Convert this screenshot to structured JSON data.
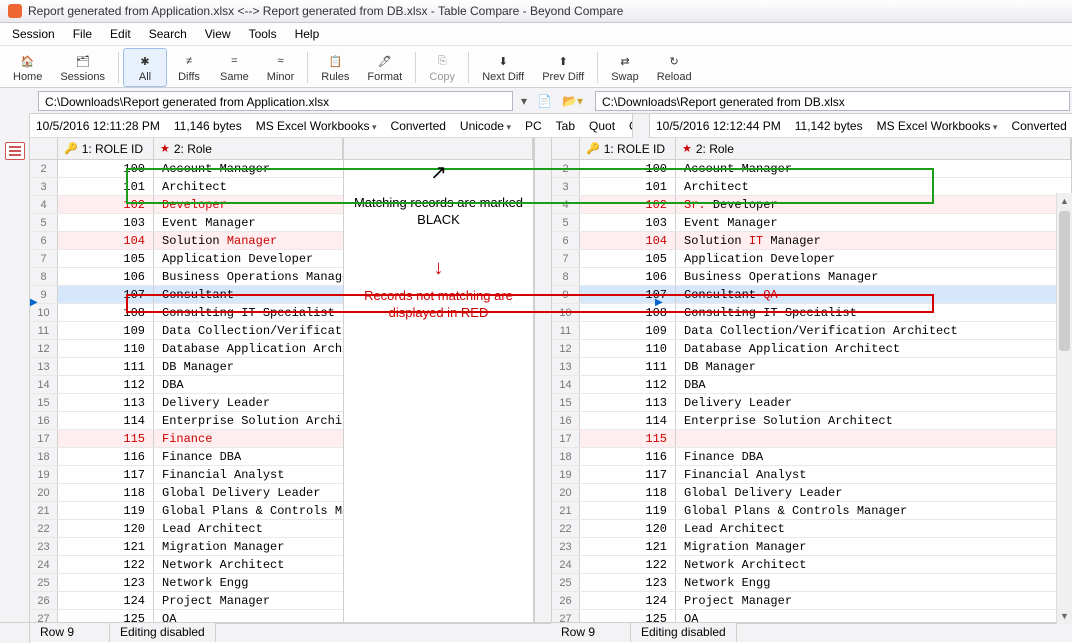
{
  "title": "Report generated from Application.xlsx <--> Report generated from DB.xlsx - Table Compare - Beyond Compare",
  "menus": [
    "Session",
    "File",
    "Edit",
    "Search",
    "View",
    "Tools",
    "Help"
  ],
  "toolbar": [
    {
      "label": "Home",
      "icon": "🏠",
      "name": "home-button"
    },
    {
      "label": "Sessions",
      "icon": "🗂",
      "name": "sessions-button"
    },
    {
      "sep": true
    },
    {
      "label": "All",
      "icon": "✱",
      "active": true,
      "name": "filter-all-button"
    },
    {
      "label": "Diffs",
      "icon": "≠",
      "name": "filter-diffs-button"
    },
    {
      "label": "Same",
      "icon": "=",
      "name": "filter-same-button"
    },
    {
      "label": "Minor",
      "icon": "≈",
      "name": "filter-minor-button"
    },
    {
      "sep": true
    },
    {
      "label": "Rules",
      "icon": "📋",
      "name": "rules-button"
    },
    {
      "label": "Format",
      "icon": "🖊",
      "name": "format-button"
    },
    {
      "sep": true
    },
    {
      "label": "Copy",
      "icon": "⎘",
      "name": "copy-button",
      "disabled": true
    },
    {
      "sep": true
    },
    {
      "label": "Next Diff",
      "icon": "⬇",
      "name": "next-diff-button"
    },
    {
      "label": "Prev Diff",
      "icon": "⬆",
      "name": "prev-diff-button"
    },
    {
      "sep": true
    },
    {
      "label": "Swap",
      "icon": "⇄",
      "name": "swap-button"
    },
    {
      "label": "Reload",
      "icon": "↻",
      "name": "reload-button"
    }
  ],
  "left": {
    "path": "C:\\Downloads\\Report generated from Application.xlsx",
    "meta": [
      "10/5/2016 12:11:28 PM",
      "11,146 bytes",
      "MS Excel Workbooks",
      "Converted",
      "Unicode",
      "PC",
      "Tab",
      "Quot",
      "C"
    ],
    "cols": [
      "1: ROLE ID",
      "2: Role"
    ],
    "rows": [
      {
        "n": 2,
        "id": "100",
        "role": "Account Manager",
        "diff": false
      },
      {
        "n": 3,
        "id": "101",
        "role": "Architect",
        "diff": false
      },
      {
        "n": 4,
        "id": "102",
        "role": "Developer",
        "diff": true,
        "idred": true,
        "rolered": true
      },
      {
        "n": 5,
        "id": "103",
        "role": "Event Manager",
        "diff": false
      },
      {
        "n": 6,
        "id": "104",
        "role": "Solution Manager",
        "diff": true,
        "idred": true,
        "roleparts": [
          {
            "t": "Solution ",
            "r": false
          },
          {
            "t": "Manager",
            "r": true
          }
        ]
      },
      {
        "n": 7,
        "id": "105",
        "role": "Application Developer",
        "diff": false
      },
      {
        "n": 8,
        "id": "106",
        "role": "Business Operations Manager",
        "diff": false
      },
      {
        "n": 9,
        "id": "107",
        "role": "Consultant",
        "diff": true,
        "sel": true
      },
      {
        "n": 10,
        "id": "108",
        "role": "Consulting IT Specialist",
        "diff": false
      },
      {
        "n": 11,
        "id": "109",
        "role": "Data Collection/Verification Architect",
        "diff": false
      },
      {
        "n": 12,
        "id": "110",
        "role": "Database Application Architect",
        "diff": false
      },
      {
        "n": 13,
        "id": "111",
        "role": "DB Manager",
        "diff": false
      },
      {
        "n": 14,
        "id": "112",
        "role": "DBA",
        "diff": false
      },
      {
        "n": 15,
        "id": "113",
        "role": "Delivery Leader",
        "diff": false
      },
      {
        "n": 16,
        "id": "114",
        "role": "Enterprise Solution Architect",
        "diff": false
      },
      {
        "n": 17,
        "id": "115",
        "role": "Finance",
        "diff": true,
        "idred": true,
        "rolered": true
      },
      {
        "n": 18,
        "id": "116",
        "role": "Finance DBA",
        "diff": false
      },
      {
        "n": 19,
        "id": "117",
        "role": "Financial Analyst",
        "diff": false
      },
      {
        "n": 20,
        "id": "118",
        "role": "Global Delivery Leader",
        "diff": false
      },
      {
        "n": 21,
        "id": "119",
        "role": "Global Plans & Controls Manager",
        "diff": false
      },
      {
        "n": 22,
        "id": "120",
        "role": "Lead Architect",
        "diff": false
      },
      {
        "n": 23,
        "id": "121",
        "role": "Migration Manager",
        "diff": false
      },
      {
        "n": 24,
        "id": "122",
        "role": "Network Architect",
        "diff": false
      },
      {
        "n": 25,
        "id": "123",
        "role": "Network Engg",
        "diff": false
      },
      {
        "n": 26,
        "id": "124",
        "role": "Project Manager",
        "diff": false
      },
      {
        "n": 27,
        "id": "125",
        "role": "QA",
        "diff": false
      }
    ]
  },
  "right": {
    "path": "C:\\Downloads\\Report generated from DB.xlsx",
    "meta": [
      "10/5/2016 12:12:44 PM",
      "11,142 bytes",
      "MS Excel Workbooks",
      "Converted"
    ],
    "cols": [
      "1: ROLE ID",
      "2: Role"
    ],
    "rows": [
      {
        "n": 2,
        "id": "100",
        "role": "Account Manager"
      },
      {
        "n": 3,
        "id": "101",
        "role": "Architect"
      },
      {
        "n": 4,
        "id": "102",
        "diff": true,
        "idred": true,
        "roleparts": [
          {
            "t": "Sr. ",
            "r": true
          },
          {
            "t": "Developer",
            "r": false
          }
        ]
      },
      {
        "n": 5,
        "id": "103",
        "role": "Event Manager"
      },
      {
        "n": 6,
        "id": "104",
        "diff": true,
        "idred": true,
        "roleparts": [
          {
            "t": "Solution ",
            "r": false
          },
          {
            "t": "IT ",
            "r": true
          },
          {
            "t": "Manager",
            "r": false
          }
        ]
      },
      {
        "n": 7,
        "id": "105",
        "role": "Application Developer"
      },
      {
        "n": 8,
        "id": "106",
        "role": "Business Operations Manager"
      },
      {
        "n": 9,
        "id": "107",
        "diff": true,
        "sel": true,
        "roleparts": [
          {
            "t": "Consultant ",
            "r": false
          },
          {
            "t": "QA",
            "r": true
          }
        ]
      },
      {
        "n": 10,
        "id": "108",
        "role": "Consulting IT Specialist"
      },
      {
        "n": 11,
        "id": "109",
        "role": "Data Collection/Verification Architect"
      },
      {
        "n": 12,
        "id": "110",
        "role": "Database Application Architect"
      },
      {
        "n": 13,
        "id": "111",
        "role": "DB Manager"
      },
      {
        "n": 14,
        "id": "112",
        "role": "DBA"
      },
      {
        "n": 15,
        "id": "113",
        "role": "Delivery Leader"
      },
      {
        "n": 16,
        "id": "114",
        "role": "Enterprise Solution Architect"
      },
      {
        "n": 17,
        "id": "115",
        "role": "",
        "diff": true,
        "idred": true
      },
      {
        "n": 18,
        "id": "116",
        "role": "Finance DBA"
      },
      {
        "n": 19,
        "id": "117",
        "role": "Financial Analyst"
      },
      {
        "n": 20,
        "id": "118",
        "role": "Global Delivery Leader"
      },
      {
        "n": 21,
        "id": "119",
        "role": "Global Plans & Controls Manager"
      },
      {
        "n": 22,
        "id": "120",
        "role": "Lead Architect"
      },
      {
        "n": 23,
        "id": "121",
        "role": "Migration Manager"
      },
      {
        "n": 24,
        "id": "122",
        "role": "Network Architect"
      },
      {
        "n": 25,
        "id": "123",
        "role": "Network Engg"
      },
      {
        "n": 26,
        "id": "124",
        "role": "Project Manager"
      },
      {
        "n": 27,
        "id": "125",
        "role": "QA"
      }
    ]
  },
  "annotations": {
    "match": "Matching records are marked BLACK",
    "nomatch": "Records not matching are displayed in RED"
  },
  "status": {
    "leftRow": "Row 9",
    "leftEdit": "Editing disabled",
    "rightRow": "Row 9",
    "rightEdit": "Editing disabled"
  }
}
